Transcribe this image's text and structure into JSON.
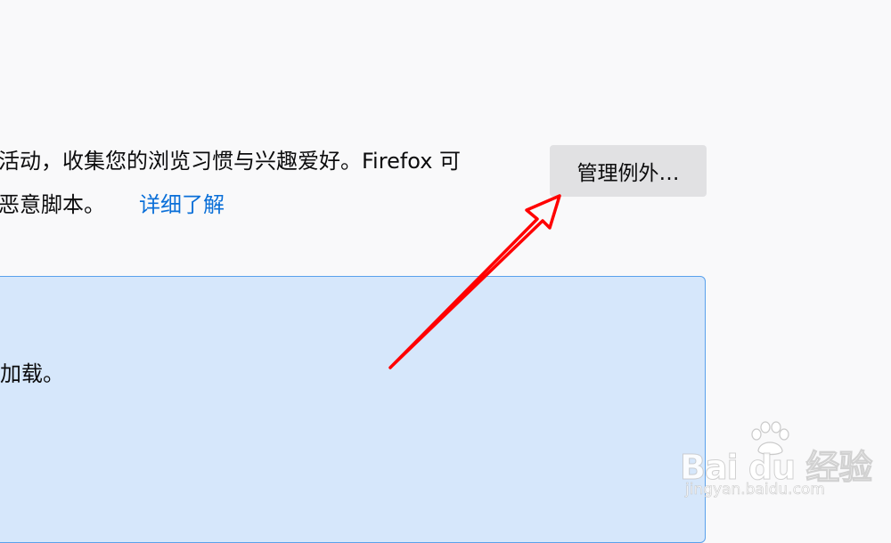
{
  "tracking": {
    "description_line1": "活动，收集您的浏览习惯与兴趣爱好。Firefox 可",
    "description_line2": "恶意脚本。",
    "learn_more_label": "详细了解",
    "manage_exceptions_label": "管理例外…"
  },
  "info_panel": {
    "text": "加载。"
  },
  "annotation": {
    "arrow_color": "#ff0000",
    "arrow_target": "manage-exceptions-button"
  },
  "watermark": {
    "logo_text": "Bai du 经验",
    "url_text": "jingyan.baidu.com"
  },
  "colors": {
    "page_background": "#f9f9fa",
    "link": "#0a6fd8",
    "button_background": "#e1e1e3",
    "info_background": "#d6e7fb",
    "info_border": "#5aa1ec"
  }
}
